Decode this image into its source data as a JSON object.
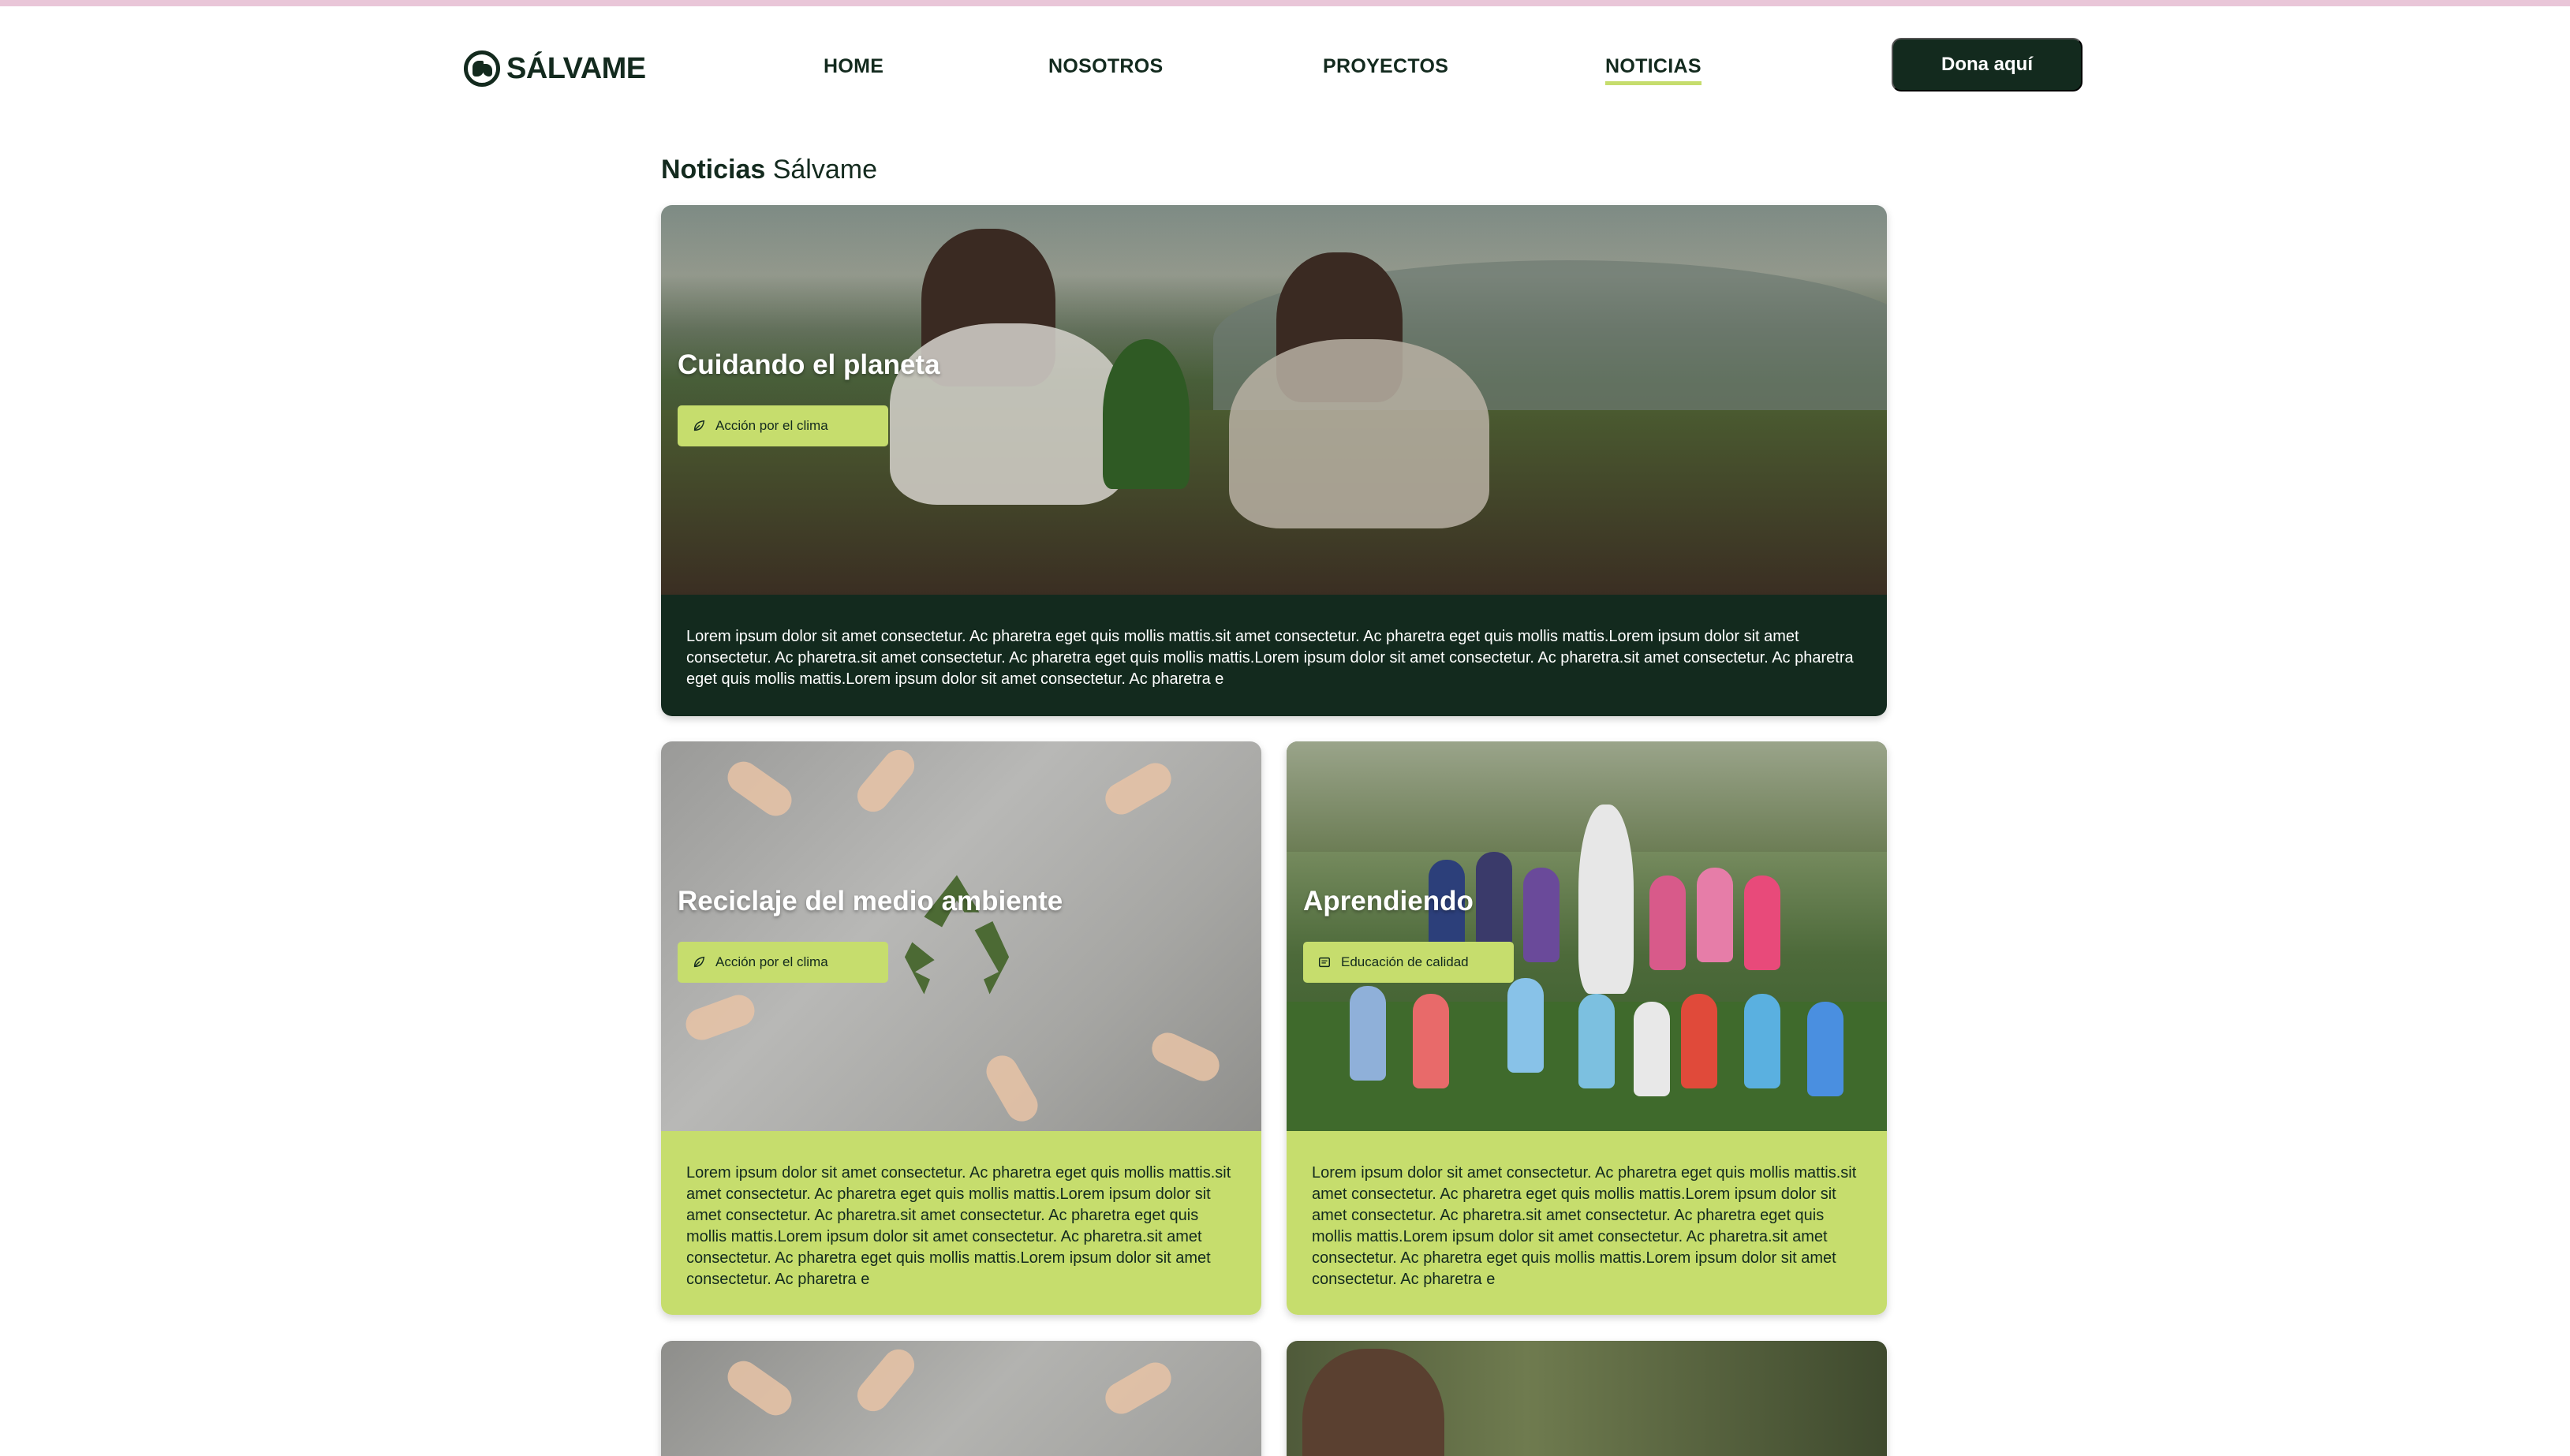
{
  "header": {
    "logo_text": "SÁLVAME",
    "nav": {
      "home": "HOME",
      "nosotros": "NOSOTROS",
      "proyectos": "PROYECTOS",
      "noticias": "NOTICIAS"
    },
    "active_nav": "NOTICIAS",
    "donate_label": "Dona aquí"
  },
  "page_title": {
    "bold": "Noticias",
    "light": "Sálvame"
  },
  "cards": [
    {
      "title": "Cuidando el planeta",
      "tag": {
        "label": "Acción por el clima",
        "icon": "leaf-icon"
      },
      "text": "Lorem ipsum dolor sit amet consectetur. Ac pharetra eget quis mollis mattis.sit amet consectetur. Ac pharetra eget quis mollis mattis.Lorem ipsum dolor sit amet consectetur. Ac pharetra.sit amet consectetur. Ac pharetra eget quis mollis mattis.Lorem ipsum dolor sit amet consectetur. Ac pharetra.sit amet consectetur. Ac pharetra eget quis mollis mattis.Lorem ipsum dolor sit amet consectetur. Ac pharetra e"
    },
    {
      "title": "Reciclaje del medio ambiente",
      "tag": {
        "label": "Acción por el clima",
        "icon": "leaf-icon"
      },
      "text": "Lorem ipsum dolor sit amet consectetur. Ac pharetra eget quis mollis mattis.sit amet consectetur. Ac pharetra eget quis mollis mattis.Lorem ipsum dolor sit amet consectetur. Ac pharetra.sit amet consectetur. Ac pharetra eget quis mollis mattis.Lorem ipsum dolor sit amet consectetur. Ac pharetra.sit amet consectetur. Ac pharetra eget quis mollis mattis.Lorem ipsum dolor sit amet consectetur. Ac pharetra e"
    },
    {
      "title": "Aprendiendo",
      "tag": {
        "label": "Educación de calidad",
        "icon": "book-icon"
      },
      "text": "Lorem ipsum dolor sit amet consectetur. Ac pharetra eget quis mollis mattis.sit amet consectetur. Ac pharetra eget quis mollis mattis.Lorem ipsum dolor sit amet consectetur. Ac pharetra.sit amet consectetur. Ac pharetra eget quis mollis mattis.Lorem ipsum dolor sit amet consectetur. Ac pharetra.sit amet consectetur. Ac pharetra eget quis mollis mattis.Lorem ipsum dolor sit amet consectetur. Ac pharetra e"
    }
  ],
  "colors": {
    "dark_green": "#132a1e",
    "lime": "#c6dd6d",
    "top_bar": "#e9c6d8"
  }
}
